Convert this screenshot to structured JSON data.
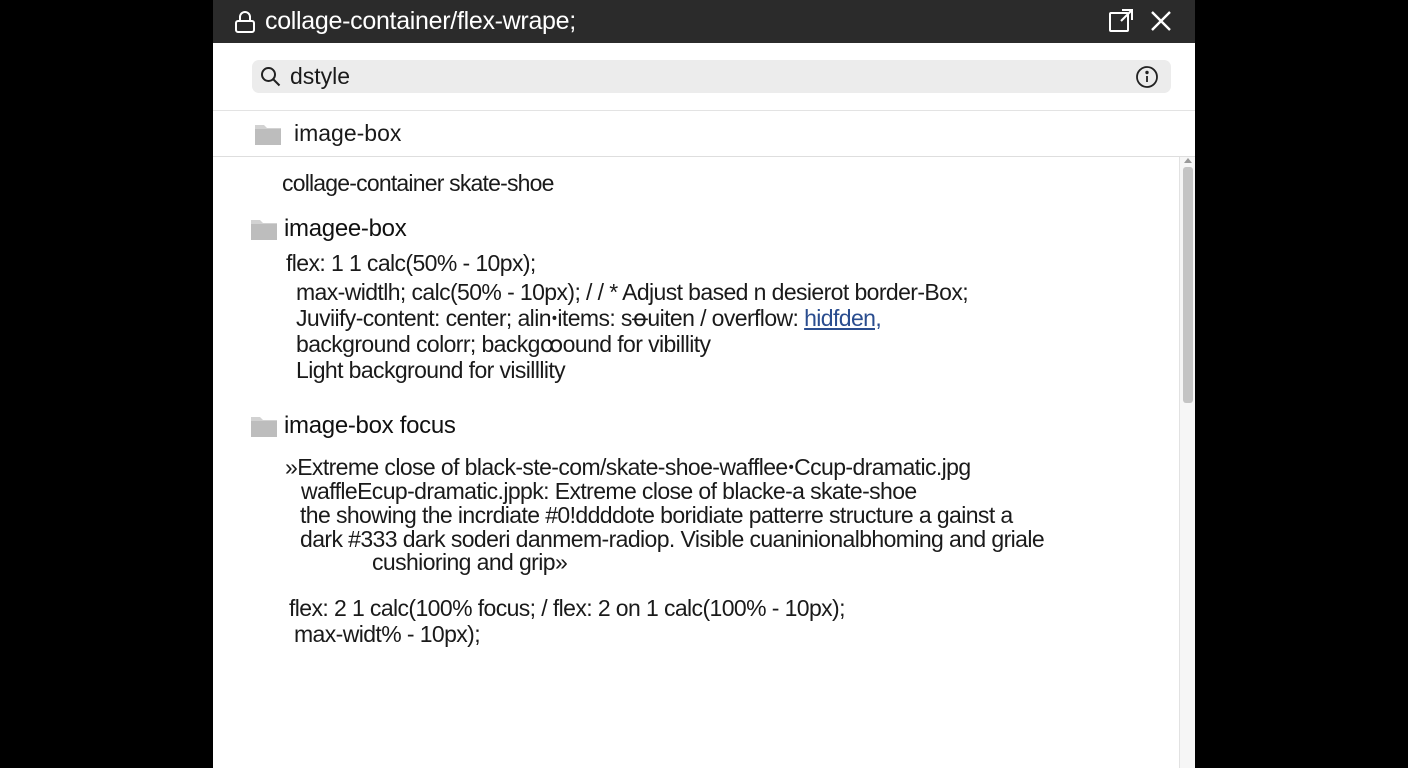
{
  "window": {
    "title": "collage-container/flex-wrape;",
    "icons": {
      "title": "lock-icon",
      "popout": "popout-icon",
      "close": "close-icon"
    }
  },
  "search": {
    "value": "dstyle",
    "icons": {
      "left": "search-icon",
      "right": "info-icon"
    }
  },
  "header": {
    "label": "image-box",
    "icon": "folder-icon"
  },
  "content": {
    "selector_line": "collage-container skate-shoe",
    "section1": {
      "title": "imagee-box",
      "line1": "flex: 1 1 calc(50% - 10px);",
      "line2": "max-widtlh; calc(50% - 10px); / / * Adjust based n desierot border-Box;",
      "line3_prefix": "Juviify-content: center; alinꞏitems: sꝋuiten / overflow: ",
      "line3_link": "hidfden,",
      "line4": "background colorr; backgꝏound for vibillity",
      "line5": "Light background for visilllity"
    },
    "section2": {
      "title": "image-box focus",
      "line1": "»Extreme close of black-ste-com/skate-shoe-waffleeꞏCcup-dramatic.jpg",
      "line2": "waffleEcup-dramatic.jppk: Extreme close of blacke-a skate-shoe",
      "line3": "the showing the incrdiate #0!ddddote boridiate patterre structure a gainst a",
      "line4": "dark #333 dark soderi danmem-radiop. Visible cuaninionalbhoming and griale",
      "line5": "cushioring and grip»"
    },
    "rule": {
      "line1": "flex: 2 1 calc(100% focus; / flex: 2 on 1 calc(100% - 10px);",
      "line2": "max-widt% - 10px);"
    }
  },
  "colors": {
    "titlebar": "#2b2b2b",
    "search_bg": "#ececec",
    "link": "#2a4d8f",
    "background": "#000000"
  }
}
